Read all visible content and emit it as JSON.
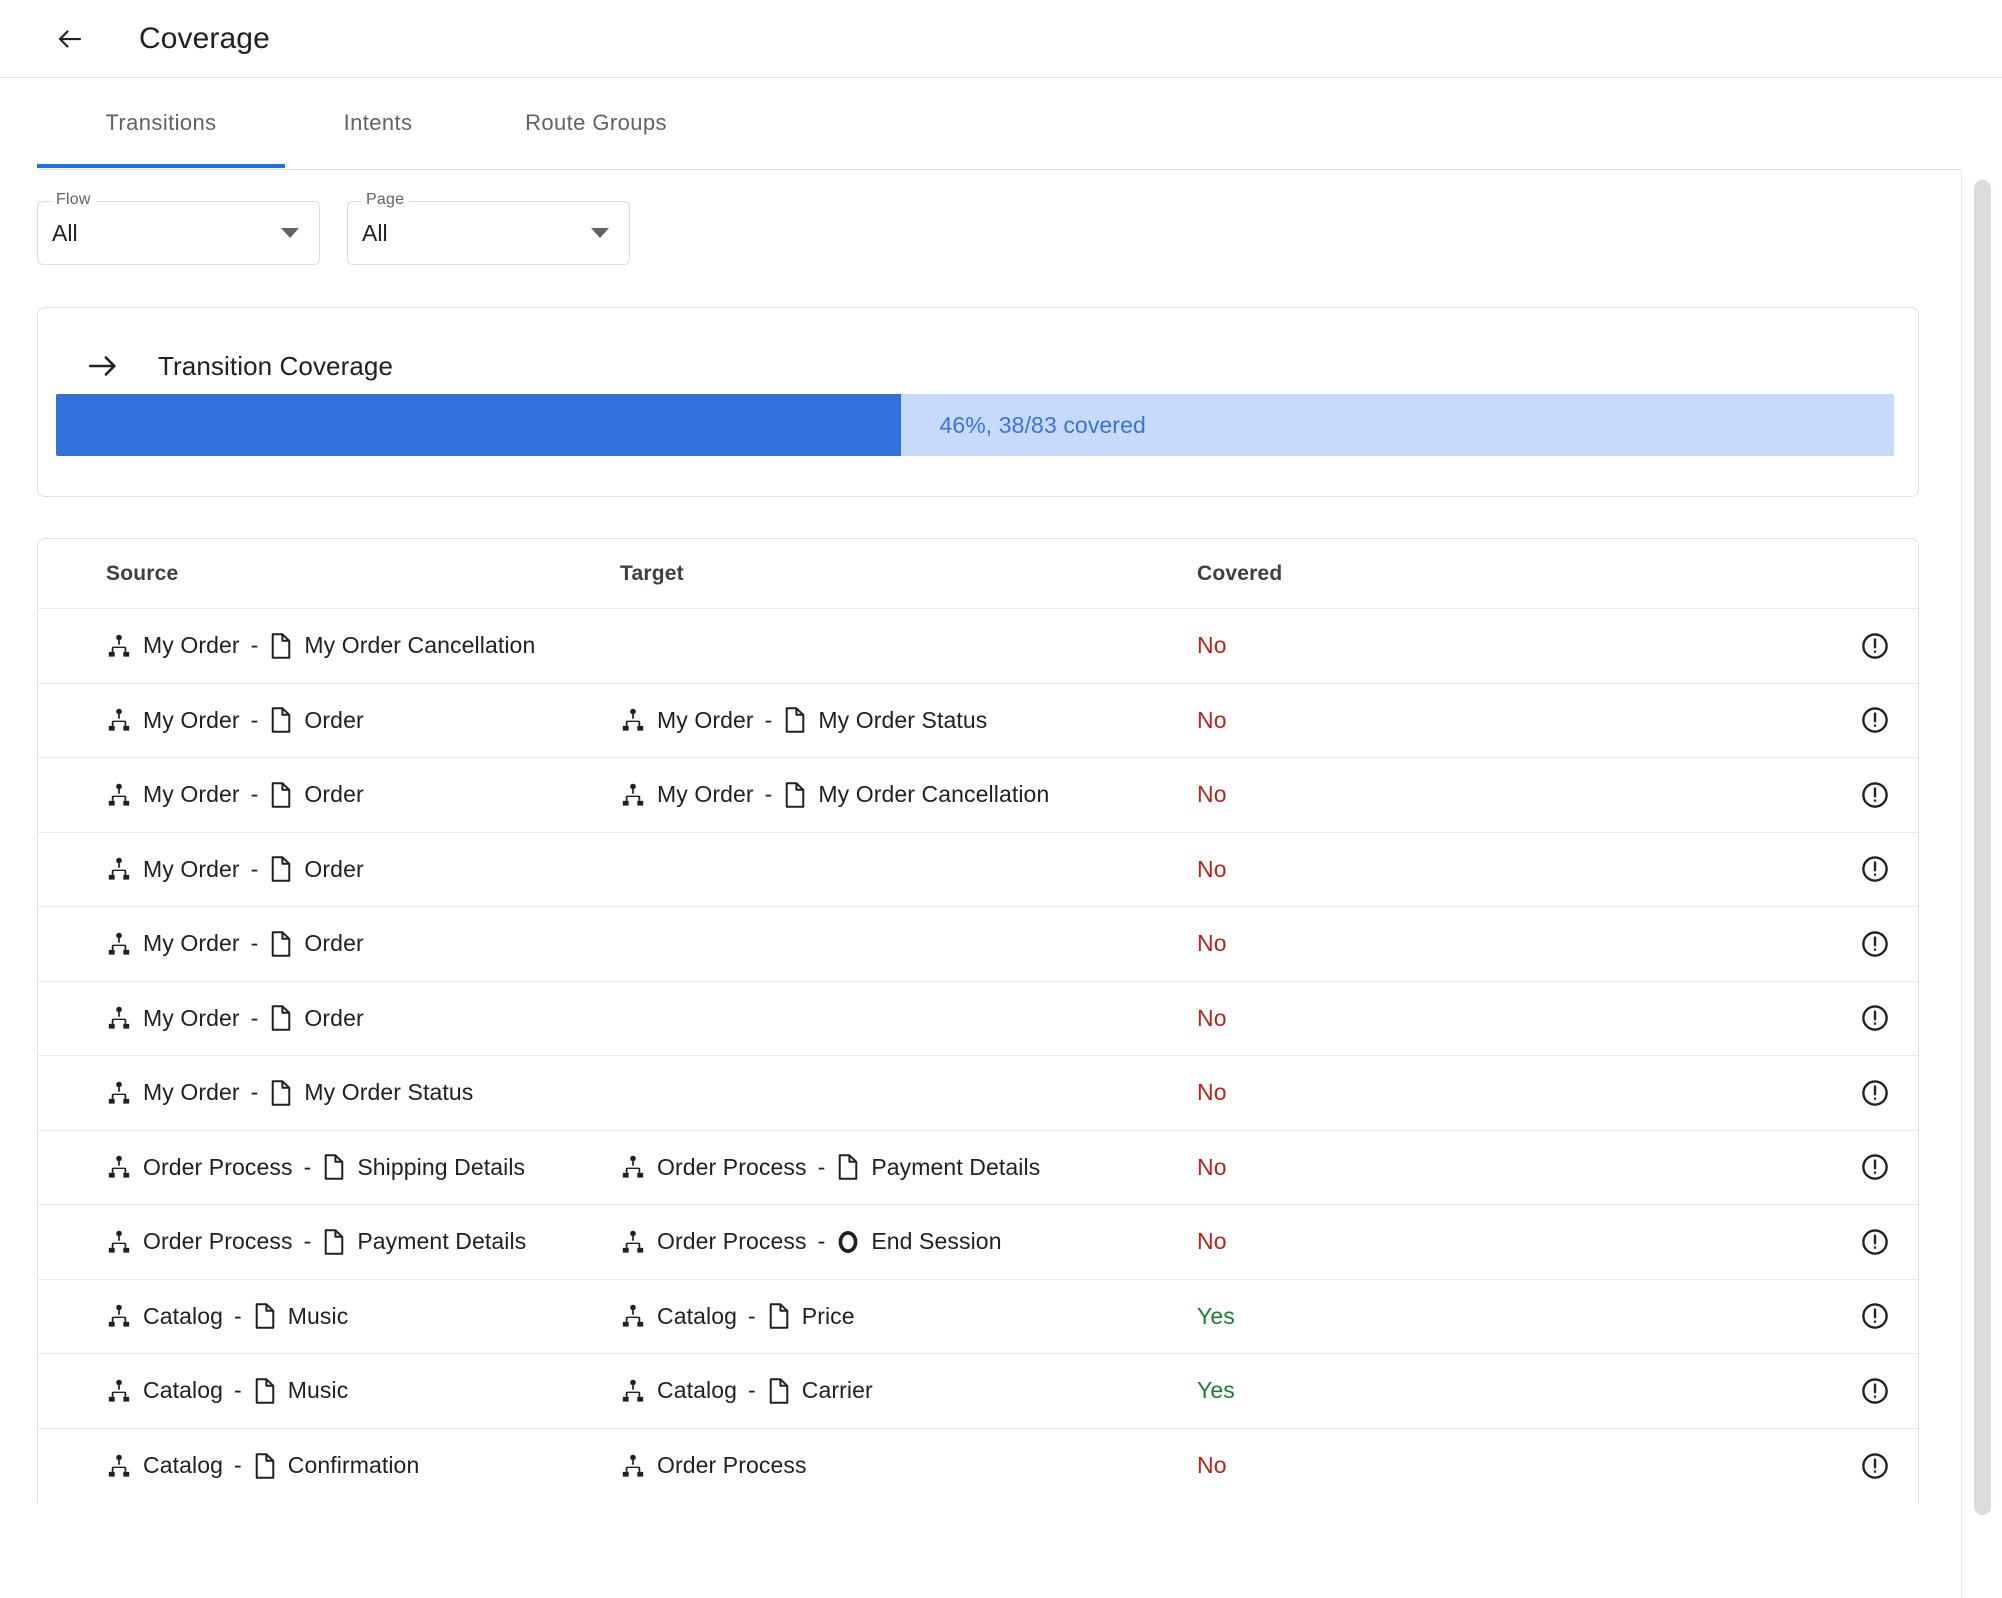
{
  "header": {
    "back_icon": "arrow-left-icon",
    "title": "Coverage"
  },
  "tabs": [
    {
      "label": "Transitions",
      "active": true
    },
    {
      "label": "Intents",
      "active": false
    },
    {
      "label": "Route Groups",
      "active": false
    }
  ],
  "filters": [
    {
      "label": "Flow",
      "value": "All",
      "icon": "chevron-down-icon"
    },
    {
      "label": "Page",
      "value": "All",
      "icon": "chevron-down-icon"
    }
  ],
  "coverage_card": {
    "icon": "arrow-right-icon",
    "title": "Transition Coverage",
    "progress_percent": 46,
    "covered_count": 38,
    "total_count": 83,
    "progress_text": "46%, 38/83 covered",
    "fill_color": "#3271dd",
    "track_color": "#c6dafc",
    "text_color": "#3b74dd"
  },
  "table": {
    "columns": [
      "Source",
      "Target",
      "Covered"
    ],
    "row_flag_icon": "error-circle-icon",
    "yes_color": "#1e7e34",
    "no_color": "#b3261e",
    "rows": [
      {
        "source": {
          "flow_icon": "account-tree-icon",
          "flow": "My Order",
          "dash": "-",
          "page_icon": "page-icon",
          "page": "My Order Cancellation"
        },
        "target": {
          "flow_icon": "",
          "flow": "",
          "dash": "",
          "page_icon": "",
          "page": ""
        },
        "covered": "No"
      },
      {
        "source": {
          "flow_icon": "account-tree-icon",
          "flow": "My Order",
          "dash": "-",
          "page_icon": "page-icon",
          "page": "Order"
        },
        "target": {
          "flow_icon": "account-tree-icon",
          "flow": "My Order",
          "dash": "-",
          "page_icon": "page-icon",
          "page": "My Order Status"
        },
        "covered": "No"
      },
      {
        "source": {
          "flow_icon": "account-tree-icon",
          "flow": "My Order",
          "dash": "-",
          "page_icon": "page-icon",
          "page": "Order"
        },
        "target": {
          "flow_icon": "account-tree-icon",
          "flow": "My Order",
          "dash": "-",
          "page_icon": "page-icon",
          "page": "My Order Cancellation"
        },
        "covered": "No"
      },
      {
        "source": {
          "flow_icon": "account-tree-icon",
          "flow": "My Order",
          "dash": "-",
          "page_icon": "page-icon",
          "page": "Order"
        },
        "target": {
          "flow_icon": "",
          "flow": "",
          "dash": "",
          "page_icon": "",
          "page": ""
        },
        "covered": "No"
      },
      {
        "source": {
          "flow_icon": "account-tree-icon",
          "flow": "My Order",
          "dash": "-",
          "page_icon": "page-icon",
          "page": "Order"
        },
        "target": {
          "flow_icon": "",
          "flow": "",
          "dash": "",
          "page_icon": "",
          "page": ""
        },
        "covered": "No"
      },
      {
        "source": {
          "flow_icon": "account-tree-icon",
          "flow": "My Order",
          "dash": "-",
          "page_icon": "page-icon",
          "page": "Order"
        },
        "target": {
          "flow_icon": "",
          "flow": "",
          "dash": "",
          "page_icon": "",
          "page": ""
        },
        "covered": "No"
      },
      {
        "source": {
          "flow_icon": "account-tree-icon",
          "flow": "My Order",
          "dash": "-",
          "page_icon": "page-icon",
          "page": "My Order Status"
        },
        "target": {
          "flow_icon": "",
          "flow": "",
          "dash": "",
          "page_icon": "",
          "page": ""
        },
        "covered": "No"
      },
      {
        "source": {
          "flow_icon": "account-tree-icon",
          "flow": "Order Process",
          "dash": "-",
          "page_icon": "page-icon",
          "page": "Shipping Details"
        },
        "target": {
          "flow_icon": "account-tree-icon",
          "flow": "Order Process",
          "dash": "-",
          "page_icon": "page-icon",
          "page": "Payment Details"
        },
        "covered": "No"
      },
      {
        "source": {
          "flow_icon": "account-tree-icon",
          "flow": "Order Process",
          "dash": "-",
          "page_icon": "page-icon",
          "page": "Payment Details"
        },
        "target": {
          "flow_icon": "account-tree-icon",
          "flow": "Order Process",
          "dash": "-",
          "page_icon": "end-session-icon",
          "page": "End Session"
        },
        "covered": "No"
      },
      {
        "source": {
          "flow_icon": "account-tree-icon",
          "flow": "Catalog",
          "dash": "-",
          "page_icon": "page-icon",
          "page": "Music"
        },
        "target": {
          "flow_icon": "account-tree-icon",
          "flow": "Catalog",
          "dash": "-",
          "page_icon": "page-icon",
          "page": "Price"
        },
        "covered": "Yes"
      },
      {
        "source": {
          "flow_icon": "account-tree-icon",
          "flow": "Catalog",
          "dash": "-",
          "page_icon": "page-icon",
          "page": "Music"
        },
        "target": {
          "flow_icon": "account-tree-icon",
          "flow": "Catalog",
          "dash": "-",
          "page_icon": "page-icon",
          "page": "Carrier"
        },
        "covered": "Yes"
      },
      {
        "source": {
          "flow_icon": "account-tree-icon",
          "flow": "Catalog",
          "dash": "-",
          "page_icon": "page-icon",
          "page": "Confirmation"
        },
        "target": {
          "flow_icon": "account-tree-icon",
          "flow": "Order Process",
          "dash": "",
          "page_icon": "",
          "page": ""
        },
        "covered": "No"
      }
    ]
  },
  "scrollbar": {
    "name": "vertical-scrollbar"
  }
}
